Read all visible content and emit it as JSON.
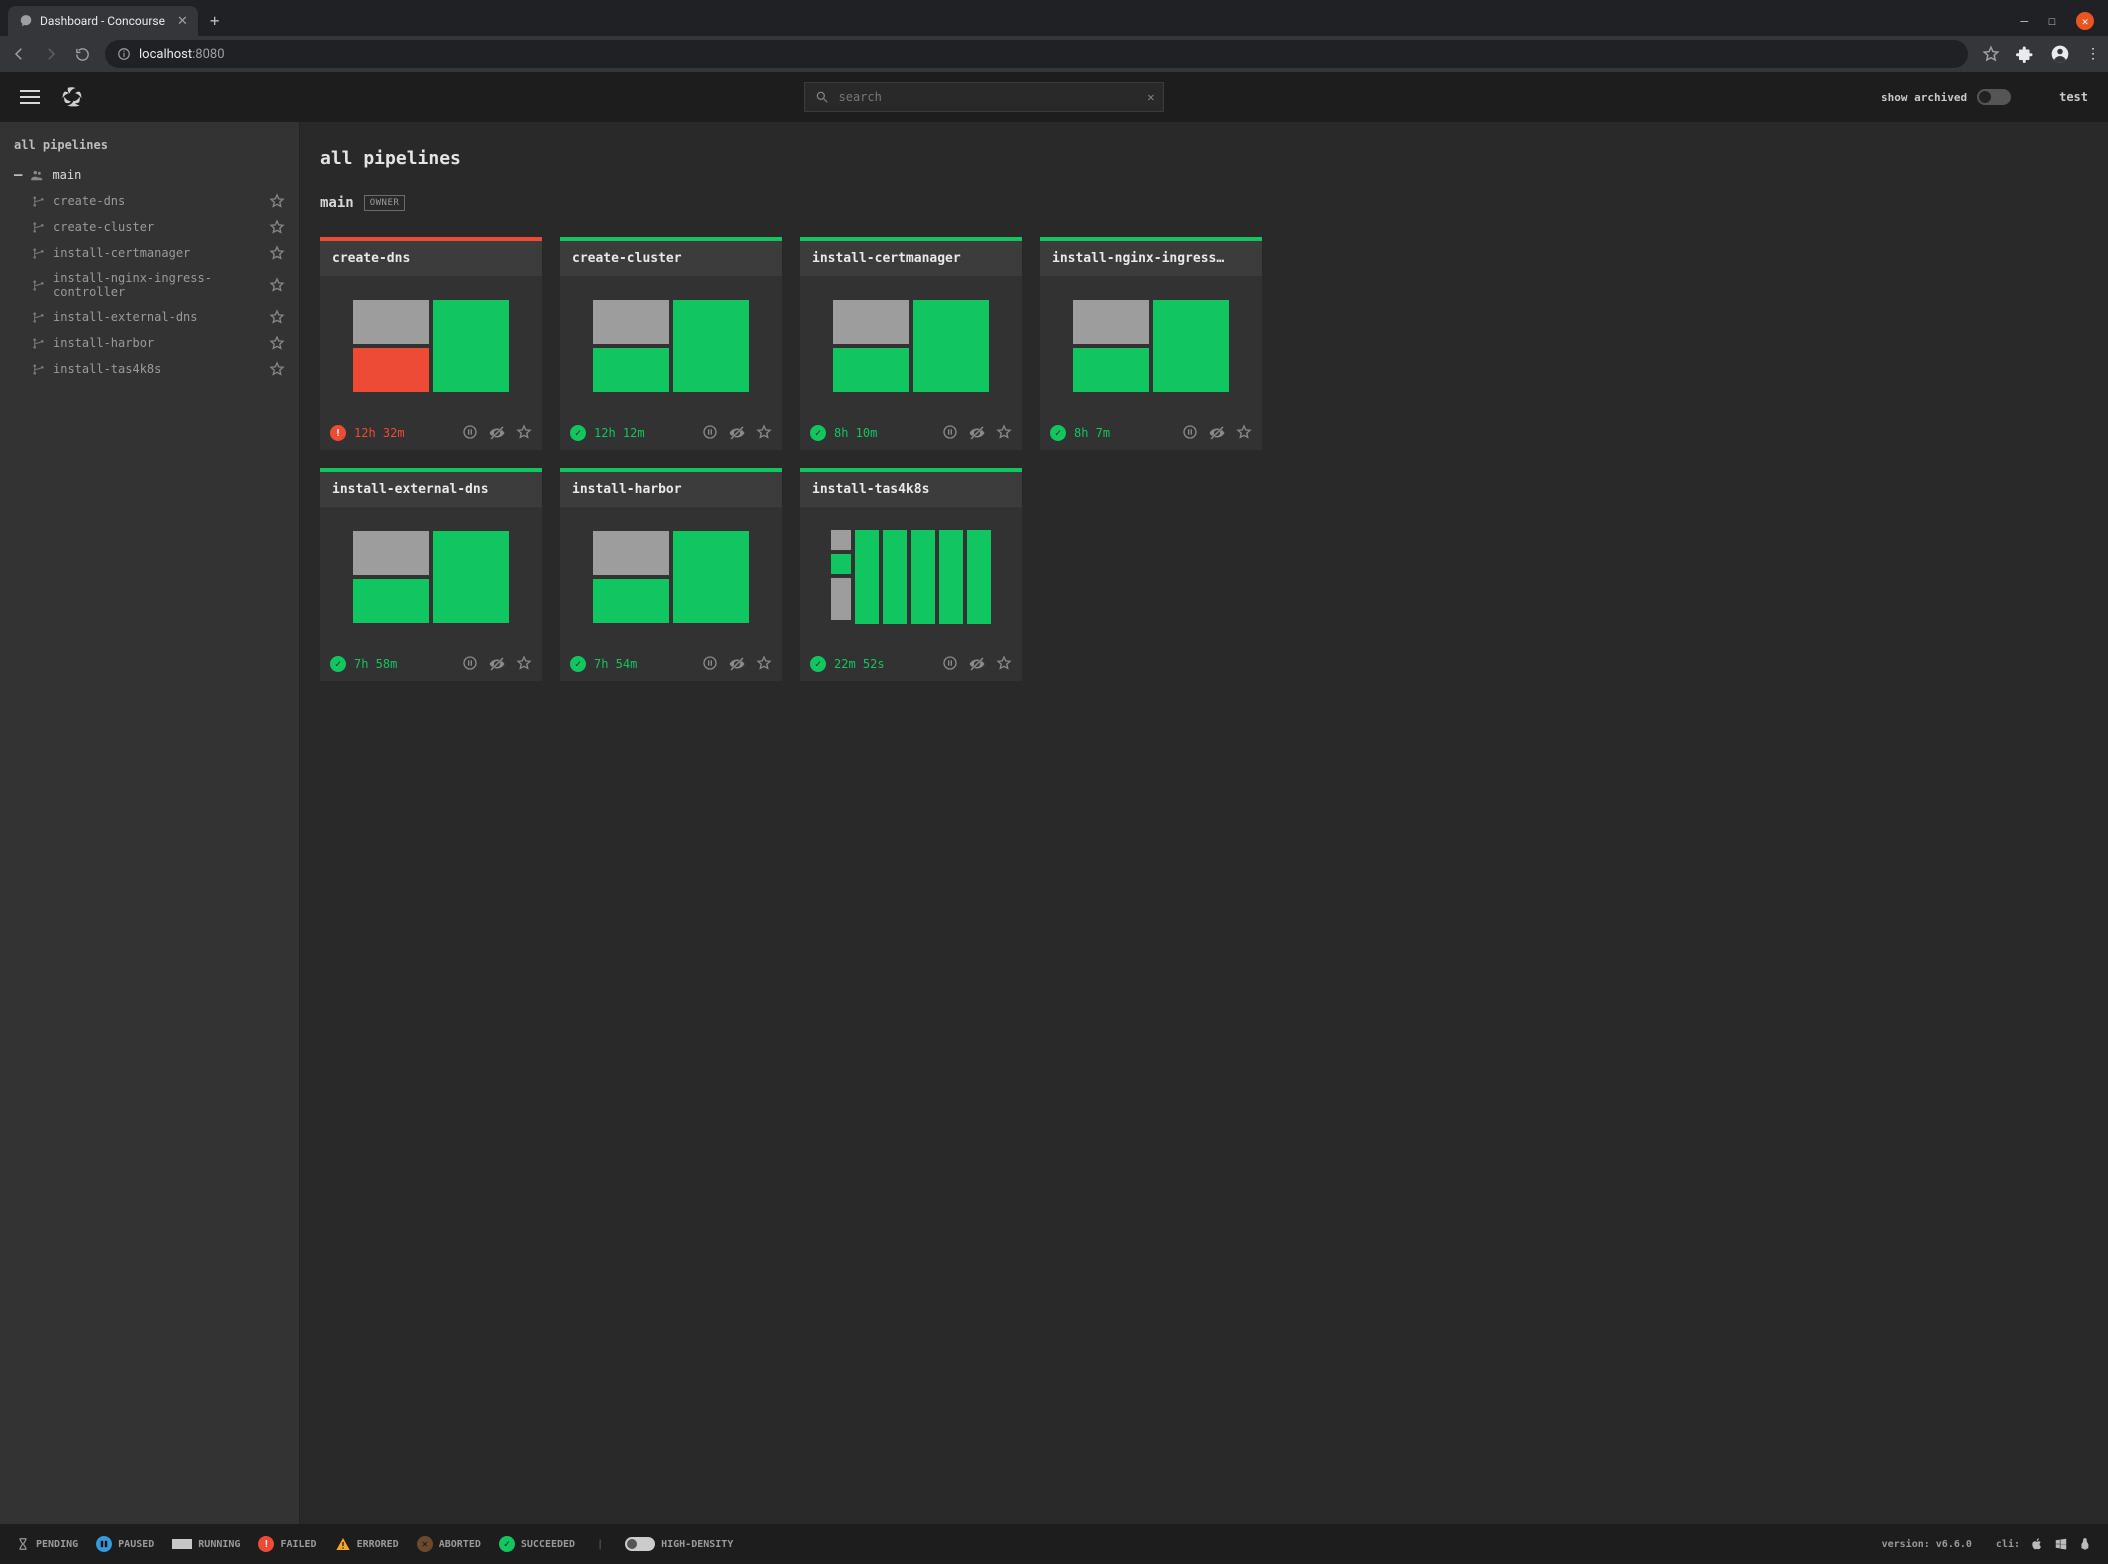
{
  "browser": {
    "tab_title": "Dashboard - Concourse",
    "url_host": "localhost",
    "url_port": ":8080"
  },
  "topbar": {
    "search_placeholder": "search",
    "show_archived_label": "show archived",
    "user": "test"
  },
  "sidebar": {
    "heading": "all pipelines",
    "team": {
      "name": "main"
    },
    "items": [
      {
        "label": "create-dns"
      },
      {
        "label": "create-cluster"
      },
      {
        "label": "install-certmanager"
      },
      {
        "label": "install-nginx-ingress-controller"
      },
      {
        "label": "install-external-dns"
      },
      {
        "label": "install-harbor"
      },
      {
        "label": "install-tas4k8s"
      }
    ]
  },
  "main": {
    "heading": "all pipelines",
    "team": {
      "name": "main",
      "badge": "OWNER"
    }
  },
  "pipelines": [
    {
      "name": "create-dns",
      "status": "fail",
      "duration": "12h 32m",
      "preview": "standard",
      "cells": [
        "gray",
        "red",
        "green_big"
      ]
    },
    {
      "name": "create-cluster",
      "status": "ok",
      "duration": "12h 12m",
      "preview": "standard",
      "cells": [
        "gray",
        "green",
        "green_big"
      ]
    },
    {
      "name": "install-certmanager",
      "status": "ok",
      "duration": "8h 10m",
      "preview": "standard",
      "cells": [
        "gray",
        "green",
        "green_big"
      ]
    },
    {
      "name": "install-nginx-ingress…",
      "status": "ok",
      "duration": "8h 7m",
      "preview": "standard",
      "cells": [
        "gray",
        "green",
        "green_big"
      ]
    },
    {
      "name": "install-external-dns",
      "status": "ok",
      "duration": "7h 58m",
      "preview": "standard",
      "cells": [
        "gray",
        "green",
        "green_big"
      ]
    },
    {
      "name": "install-harbor",
      "status": "ok",
      "duration": "7h 54m",
      "preview": "standard",
      "cells": [
        "gray",
        "green",
        "green_big"
      ]
    },
    {
      "name": "install-tas4k8s",
      "status": "ok",
      "duration": "22m 52s",
      "preview": "vbars"
    }
  ],
  "legend": {
    "pending": "PENDING",
    "paused": "PAUSED",
    "running": "RUNNING",
    "failed": "FAILED",
    "errored": "ERRORED",
    "aborted": "ABORTED",
    "succeeded": "SUCCEEDED",
    "high_density": "HIGH-DENSITY",
    "version": "version: v6.6.0",
    "cli_label": "cli:"
  },
  "colors": {
    "green": "#11c560",
    "red": "#ed4b35",
    "gray": "#9d9d9d"
  }
}
